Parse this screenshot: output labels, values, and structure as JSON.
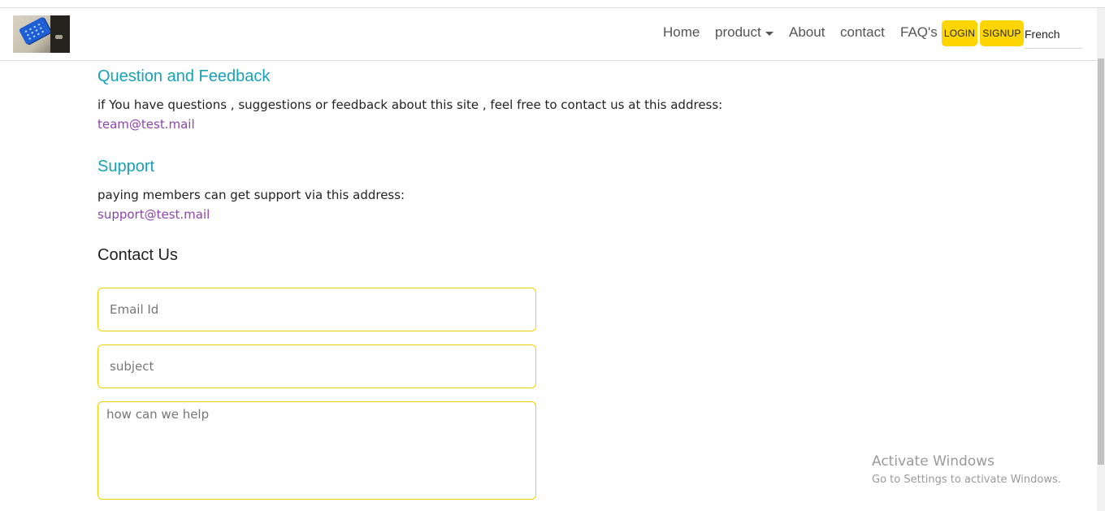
{
  "navbar": {
    "logo_icon": "payment-terminal-logo-icon",
    "links": {
      "home": "Home",
      "product": "product",
      "about": "About",
      "contact": "contact",
      "faq": "FAQ's"
    },
    "login_label": "LOGIN",
    "signup_label": "SIGNUP",
    "language_selected": "French",
    "button_color": "#ffd500"
  },
  "feedback": {
    "heading": "Question and Feedback",
    "text": "if You have questions , suggestions or feedback about this site , feel free to contact us at this address:",
    "email": "team@test.mail"
  },
  "support": {
    "heading": "Support",
    "text": "paying members can get support via this address:",
    "email": "support@test.mail"
  },
  "contact_form": {
    "heading": "Contact Us",
    "email_placeholder": "Email Id",
    "subject_placeholder": "subject",
    "message_placeholder": "how can we help",
    "border_color": "#f0d000"
  },
  "colors": {
    "heading_accent": "#17a2b8",
    "link": "#8e44ad"
  },
  "watermark": {
    "title": "Activate Windows",
    "subtitle": "Go to Settings to activate Windows."
  }
}
